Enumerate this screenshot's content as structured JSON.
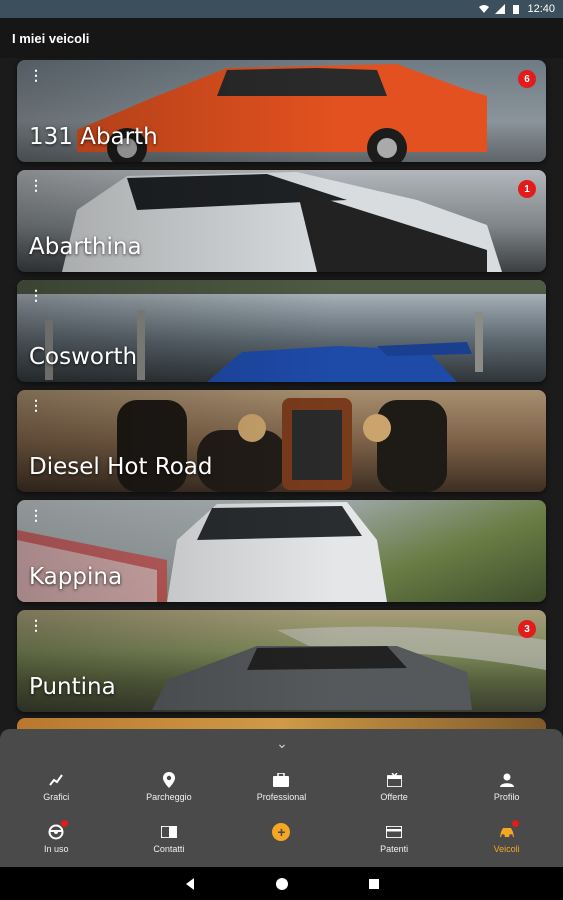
{
  "status": {
    "time": "12:40"
  },
  "header": {
    "title": "I miei veicoli"
  },
  "vehicles": [
    {
      "name": "131 Abarth",
      "badge": "6",
      "bg": "orange"
    },
    {
      "name": "Abarthina",
      "badge": "1",
      "bg": "white"
    },
    {
      "name": "Cosworth",
      "badge": "",
      "bg": "lake"
    },
    {
      "name": "Diesel Hot Road",
      "badge": "",
      "bg": "desert"
    },
    {
      "name": "Kappina",
      "badge": "",
      "bg": "track"
    },
    {
      "name": "Puntina",
      "badge": "3",
      "bg": "hill"
    }
  ],
  "bottom_menu": {
    "row1": [
      {
        "label": "Grafici",
        "icon": "chart-icon"
      },
      {
        "label": "Parcheggio",
        "icon": "location-pin-icon"
      },
      {
        "label": "Professional",
        "icon": "briefcase-icon"
      },
      {
        "label": "Offerte",
        "icon": "offer-icon"
      },
      {
        "label": "Profilo",
        "icon": "person-icon"
      }
    ],
    "row2": [
      {
        "label": "In uso",
        "icon": "steering-wheel-icon"
      },
      {
        "label": "Contatti",
        "icon": "contacts-icon"
      },
      {
        "label": "",
        "icon": "plus-icon"
      },
      {
        "label": "Patenti",
        "icon": "license-card-icon"
      },
      {
        "label": "Veicoli",
        "icon": "car-icon"
      }
    ]
  },
  "colors": {
    "accent": "#f5a623",
    "badge": "#e21b1b"
  }
}
